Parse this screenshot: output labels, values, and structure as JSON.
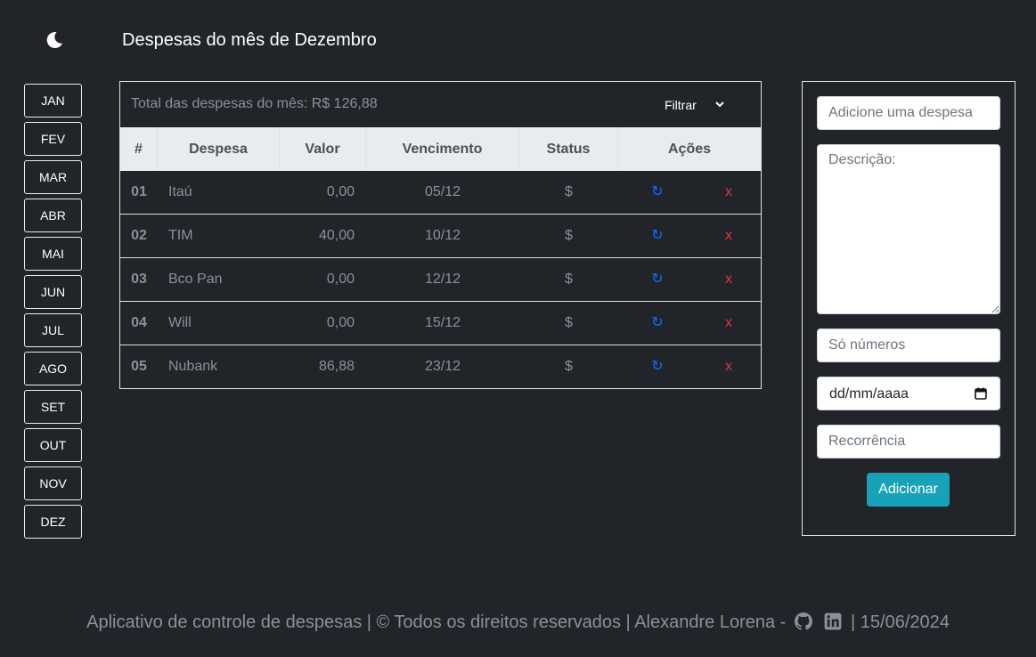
{
  "header": {
    "title": "Despesas do mês de Dezembro",
    "theme_icon": "moon-icon"
  },
  "months": [
    "JAN",
    "FEV",
    "MAR",
    "ABR",
    "MAI",
    "JUN",
    "JUL",
    "AGO",
    "SET",
    "OUT",
    "NOV",
    "DEZ"
  ],
  "summary": {
    "total_text": "Total das despesas do mês: R$ 126,88",
    "filter_label": "Filtrar"
  },
  "table": {
    "columns": [
      "#",
      "Despesa",
      "Valor",
      "Vencimento",
      "Status",
      "Ações"
    ],
    "rows": [
      {
        "num": "01",
        "name": "Itaú",
        "value": "0,00",
        "due": "05/12",
        "status": "$",
        "refresh": "↻",
        "delete": "x"
      },
      {
        "num": "02",
        "name": "TIM",
        "value": "40,00",
        "due": "10/12",
        "status": "$",
        "refresh": "↻",
        "delete": "x"
      },
      {
        "num": "03",
        "name": "Bco Pan",
        "value": "0,00",
        "due": "12/12",
        "status": "$",
        "refresh": "↻",
        "delete": "x"
      },
      {
        "num": "04",
        "name": "Will",
        "value": "0,00",
        "due": "15/12",
        "status": "$",
        "refresh": "↻",
        "delete": "x"
      },
      {
        "num": "05",
        "name": "Nubank",
        "value": "86,88",
        "due": "23/12",
        "status": "$",
        "refresh": "↻",
        "delete": "x"
      }
    ]
  },
  "form": {
    "name_placeholder": "Adicione uma despesa",
    "description_placeholder": "Descrição:",
    "value_placeholder": "Só números",
    "date_placeholder": "dd/mm/aaaa",
    "recurrence_placeholder": "Recorrência",
    "submit_label": "Adicionar"
  },
  "footer": {
    "text": "Aplicativo de controle de despesas | © Todos os direitos reservados | Alexandre Lorena",
    "separator": "-",
    "date_text": "| 15/06/2024",
    "github_icon": "github-icon",
    "linkedin_icon": "linkedin-icon"
  },
  "colors": {
    "background": "#212529",
    "header_row": "#e9ecef",
    "accent_button": "#17a2b8",
    "refresh": "#0d6efd",
    "delete": "#dc3545"
  }
}
